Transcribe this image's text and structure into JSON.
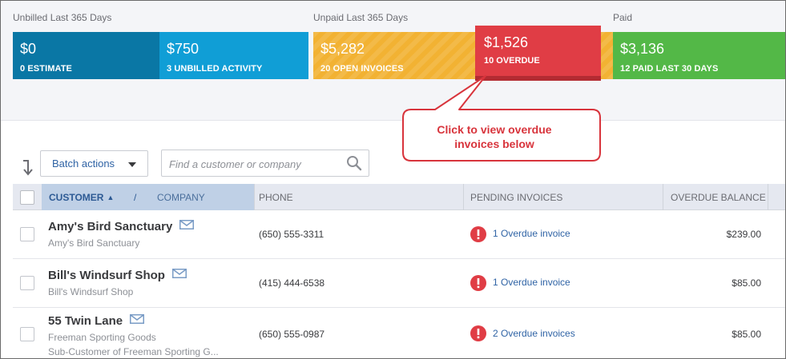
{
  "moneybar": {
    "unbilled_label": "Unbilled Last 365 Days",
    "unpaid_label": "Unpaid Last 365 Days",
    "paid_label": "Paid",
    "tiles": {
      "estimate": {
        "amount": "$0",
        "label": "0 ESTIMATE",
        "color": "#0a77a5"
      },
      "unbilled": {
        "amount": "$750",
        "label": "3 UNBILLED ACTIVITY",
        "color": "#109ed6"
      },
      "open": {
        "amount": "$5,282",
        "label": "20 OPEN INVOICES",
        "color": "#f2b233"
      },
      "overdue": {
        "amount": "$1,526",
        "label": "10 OVERDUE",
        "color": "#e03d45"
      },
      "paid": {
        "amount": "$3,136",
        "label": "12 PAID LAST 30 DAYS",
        "color": "#53b847"
      }
    }
  },
  "callout": {
    "line1": "Click to view overdue",
    "line2": "invoices below"
  },
  "toolbar": {
    "batch_label": "Batch actions",
    "search_placeholder": "Find a customer or company",
    "sort_icon": "sort-down-arrow-icon",
    "search_icon": "magnifier-icon"
  },
  "table": {
    "headers": {
      "customer": "CUSTOMER",
      "slash": "/",
      "company": "COMPANY",
      "phone": "PHONE",
      "pending": "PENDING INVOICES",
      "overdue": "OVERDUE BALANCE"
    },
    "rows": [
      {
        "customer": "Amy's Bird Sanctuary",
        "company": "Amy's Bird Sanctuary",
        "sub": "",
        "phone": "(650) 555-3311",
        "pending": "1 Overdue invoice",
        "balance": "$239.00"
      },
      {
        "customer": "Bill's Windsurf Shop",
        "company": "Bill's Windsurf Shop",
        "sub": "",
        "phone": "(415) 444-6538",
        "pending": "1 Overdue invoice",
        "balance": "$85.00"
      },
      {
        "customer": "55 Twin Lane",
        "company": "Freeman Sporting Goods",
        "sub": "Sub-Customer of Freeman Sporting G...",
        "phone": "(650) 555-0987",
        "pending": "2 Overdue invoices",
        "balance": "$85.00"
      }
    ]
  },
  "colors": {
    "link": "#2f63a5",
    "callout_red": "#d8343c",
    "alert_red": "#e03d45"
  }
}
